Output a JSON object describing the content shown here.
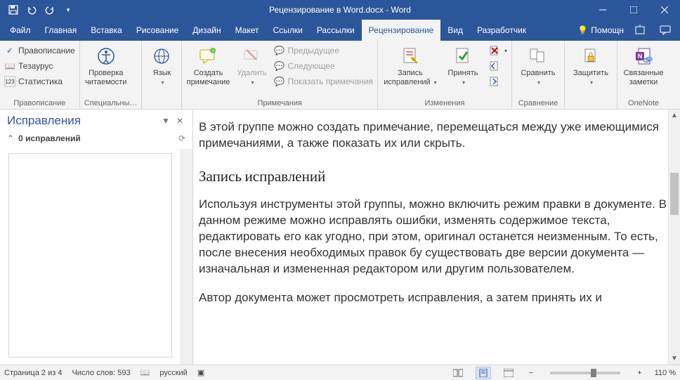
{
  "title": "Рецензирование в Word.docx - Word",
  "tabs": [
    "Файл",
    "Главная",
    "Вставка",
    "Рисование",
    "Дизайн",
    "Макет",
    "Ссылки",
    "Рассылки",
    "Рецензирование",
    "Вид",
    "Разработчик"
  ],
  "active_tab_index": 8,
  "help_label": "Помощн",
  "ribbon": {
    "proofing": {
      "spelling": "Правописание",
      "thesaurus": "Тезаурус",
      "statistics": "Статистика",
      "group_label": "Правописание"
    },
    "accessibility": {
      "label": "Проверка\nчитаемости",
      "group_label": "Специальны…"
    },
    "language": {
      "label": "Язык",
      "group_label": ""
    },
    "comments": {
      "new": "Создать\nпримечание",
      "delete": "Удалить",
      "prev": "Предыдущее",
      "next": "Следующее",
      "show": "Показать примечания",
      "group_label": "Примечания"
    },
    "tracking": {
      "track": "Запись\nисправлений",
      "accept": "Принять",
      "group_label": "Изменения"
    },
    "compare": {
      "label": "Сравнить",
      "group_label": "Сравнение"
    },
    "protect": {
      "label": "Защитить",
      "group_label": ""
    },
    "onenote": {
      "label": "Связанные\nзаметки",
      "group_label": "OneNote"
    }
  },
  "revisions_pane": {
    "title": "Исправления",
    "count_label": "0 исправлений"
  },
  "document": {
    "p1": "В этой группе можно создать примечание, перемещаться между уже имеющимися примечаниями, а также показать их или скрыть.",
    "h2": "Запись исправлений",
    "p2": "Используя инструменты этой группы, можно включить режим правки в документе. В данном режиме можно исправлять ошибки, изменять содержимое текста, редактировать его как угодно, при этом, оригинал останется неизменным. То есть, после внесения необходимых правок бу существовать две версии документа — изначальная и измененная редактором или другим пользователем.",
    "p3": "Автор документа может просмотреть исправления, а затем принять их и"
  },
  "statusbar": {
    "page": "Страница 2 из 4",
    "words": "Число слов: 593",
    "language": "русский",
    "zoom": "110 %"
  }
}
